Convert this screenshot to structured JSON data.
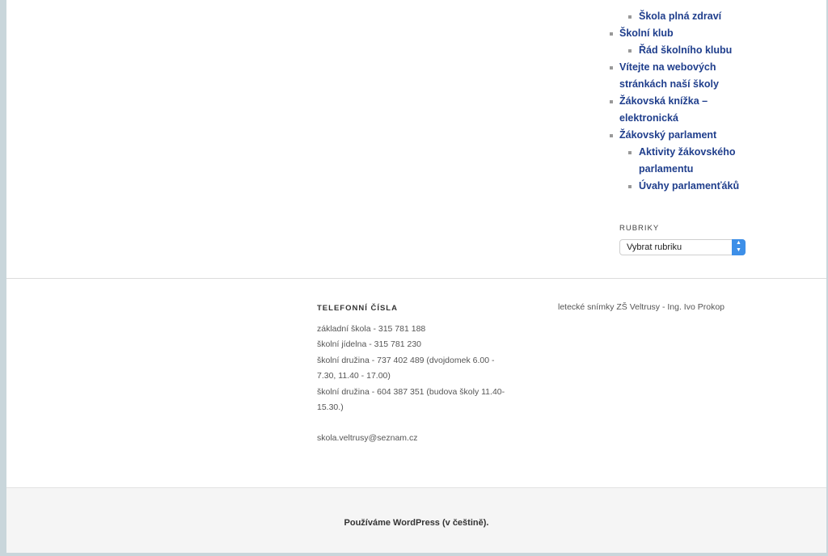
{
  "nav": {
    "items": [
      {
        "label": "Škola plná zdraví",
        "level": 1
      },
      {
        "label": "Školní klub",
        "level": 0
      },
      {
        "label": "Řád školního klubu",
        "level": 1
      },
      {
        "label": "Vítejte na webových",
        "level": 0
      },
      {
        "label": "stránkách naší školy",
        "level": 0,
        "continuation": true
      },
      {
        "label": "Žákovská knížka –",
        "level": 0
      },
      {
        "label": "elektronická",
        "level": 0,
        "continuation": true
      },
      {
        "label": "Žákovský parlament",
        "level": 0
      },
      {
        "label": "Aktivity žákovského",
        "level": 1
      },
      {
        "label": "parlamentu",
        "level": 1,
        "continuation": true
      },
      {
        "label": "Úvahy parlamenťáků",
        "level": 1
      }
    ]
  },
  "rubriky": {
    "title": "RUBRIKY",
    "selected": "Vybrat rubriku"
  },
  "phones": {
    "title": "TELEFONNÍ ČÍSLA",
    "lines": [
      "základní škola - 315 781 188",
      "školní jídelna - 315 781 230",
      "školní družina - 737 402 489 (dvojdomek 6.00 -",
      "7.30, 11.40 - 17.00)",
      "školní družina - 604 387 351 (budova školy 11.40-",
      "15.30.)"
    ],
    "email": "skola.veltrusy@seznam.cz"
  },
  "photo_credit": "letecké snímky ZŠ Veltrusy - Ing. Ivo Prokop",
  "footer": {
    "text": "Používáme WordPress (v češtině)."
  }
}
